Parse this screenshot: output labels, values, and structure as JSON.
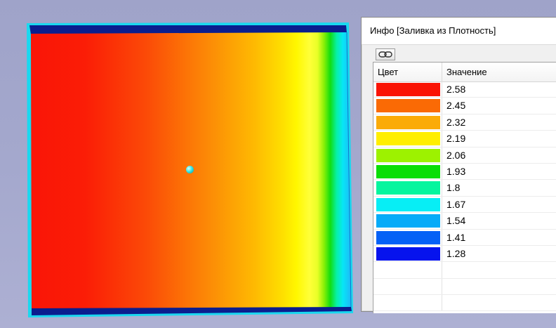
{
  "info_window": {
    "title": "Инфо [Заливка из Плотность]"
  },
  "toolbar": {
    "link_icon": "chain-link-icon"
  },
  "table": {
    "columns": [
      "Цвет",
      "Значение"
    ],
    "rows": [
      {
        "color": "#fa1405",
        "value": "2.58"
      },
      {
        "color": "#fa6a05",
        "value": "2.45"
      },
      {
        "color": "#fbab08",
        "value": "2.32"
      },
      {
        "color": "#ffee00",
        "value": "2.19"
      },
      {
        "color": "#9df200",
        "value": "2.06"
      },
      {
        "color": "#0ade06",
        "value": "1.93"
      },
      {
        "color": "#06f59e",
        "value": "1.8"
      },
      {
        "color": "#07eef5",
        "value": "1.67"
      },
      {
        "color": "#06abf8",
        "value": "1.54"
      },
      {
        "color": "#0561f6",
        "value": "1.41"
      },
      {
        "color": "#0613ee",
        "value": "1.28"
      }
    ]
  },
  "colors": {
    "plate_outline": "#1ad8ef",
    "plate_edge": "#0a1e8e",
    "viewport_background": "#a4a8cd"
  }
}
